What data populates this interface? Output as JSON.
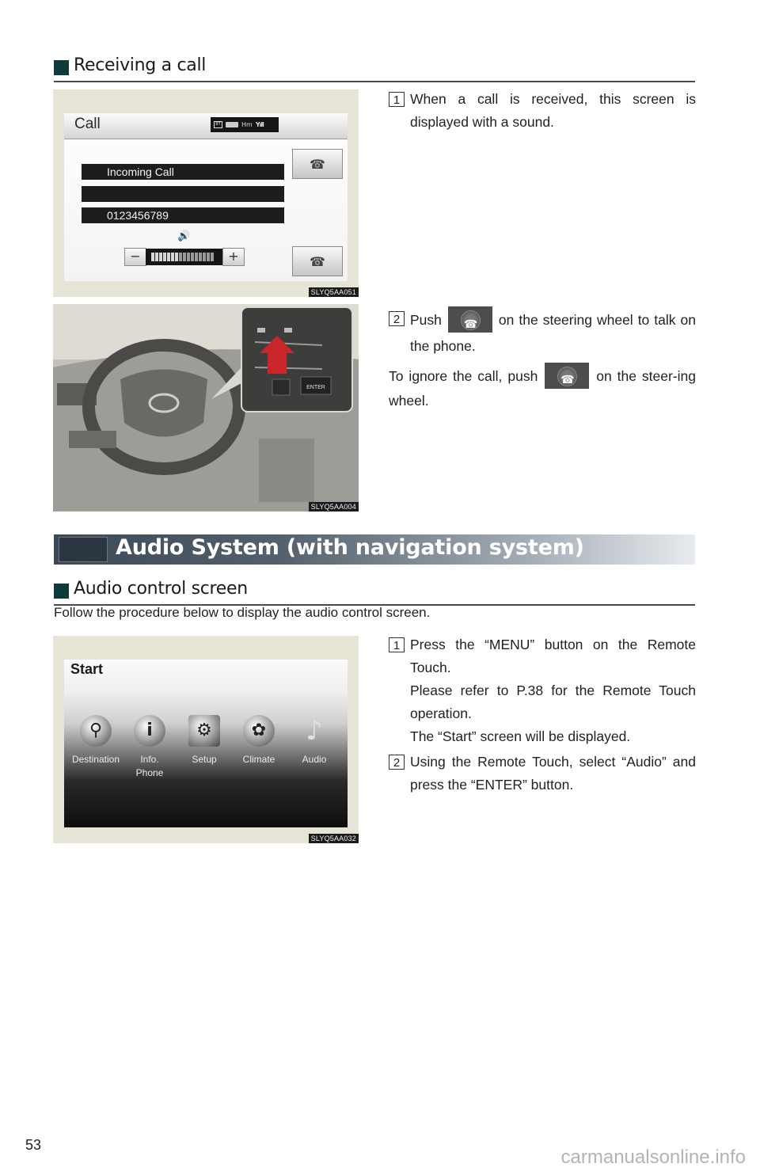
{
  "section1": {
    "heading": "Receiving a call",
    "figure1": {
      "caption": "SLYQ5AA051",
      "screen_title": "Call",
      "status": {
        "bt": "BT",
        "hm": "Hm",
        "signal": "Yıll"
      },
      "rows": [
        "Incoming Call",
        "",
        "0123456789"
      ],
      "buttons": {
        "answer_icon": "phone-off-hook-icon",
        "hangup_icon": "phone-hang-up-icon"
      },
      "volume": {
        "minus": "−",
        "plus": "+",
        "segments_total": 16,
        "segments_active": 7,
        "speaker_icon": "🔊"
      }
    },
    "figure2": {
      "caption": "SLYQ5AA004",
      "enter_label": "ENTER"
    },
    "steps": [
      {
        "num": "1",
        "text": "When a call is received, this screen is displayed with a sound."
      },
      {
        "num": "2",
        "text_before": "Push",
        "text_after": "on the steering wheel to talk on the phone."
      }
    ],
    "ignore_note": {
      "before": "To ignore the call, push",
      "after": "on the steer-ing wheel."
    },
    "phone_icon_glyph": "☎"
  },
  "banner": {
    "title": "Audio System (with navigation system)"
  },
  "section2": {
    "heading": "Audio control screen",
    "intro": "Follow the procedure below to display the audio control screen.",
    "figure": {
      "caption": "SLYQ5AA032",
      "screen_title": "Start",
      "items": [
        {
          "label": "Destination",
          "glyph": "⚲"
        },
        {
          "label": "Info.\nPhone",
          "label_line1": "Info.",
          "label_line2": "Phone",
          "glyph": "i"
        },
        {
          "label": "Setup",
          "glyph": "⚙"
        },
        {
          "label": "Climate",
          "glyph": "✿"
        },
        {
          "label": "Audio",
          "glyph": "♪"
        }
      ]
    },
    "steps": [
      {
        "num": "1",
        "lines": [
          "Press the “MENU” button on the Remote Touch.",
          "Please refer to P.38 for the Remote Touch operation.",
          "The “Start” screen will be displayed."
        ]
      },
      {
        "num": "2",
        "lines": [
          "Using the Remote Touch, select “Audio” and press the “ENTER” button."
        ]
      }
    ]
  },
  "footer": {
    "page_number": "53",
    "watermark": "carmanualsonline.info"
  }
}
